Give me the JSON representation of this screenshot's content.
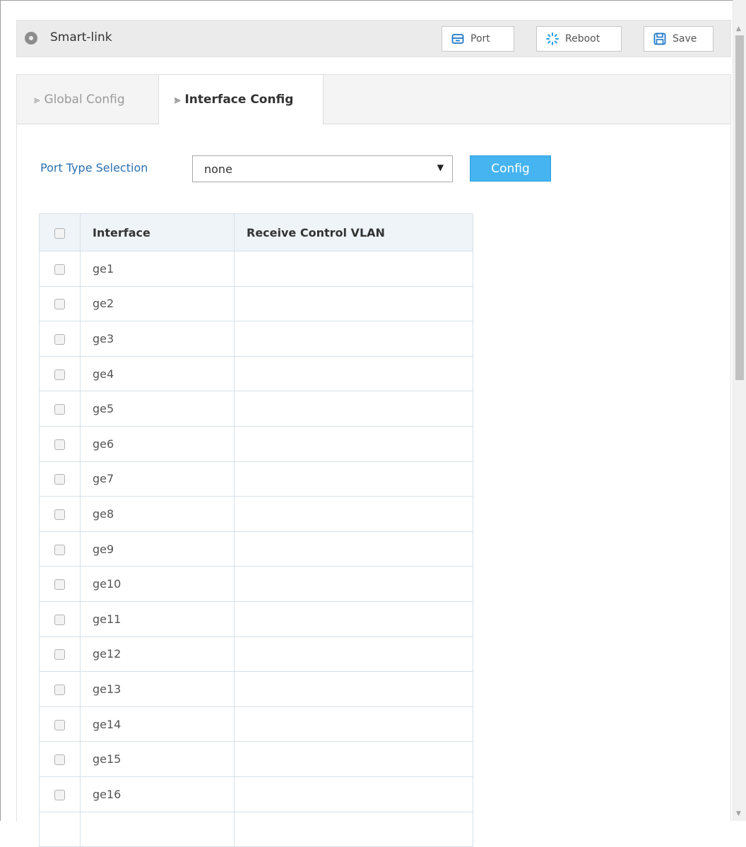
{
  "header": {
    "title": "Smart-link",
    "port_label": "Port",
    "reboot_label": "Reboot",
    "save_label": "Save"
  },
  "tabs": [
    {
      "label": "Global Config",
      "active": false
    },
    {
      "label": "Interface Config",
      "active": true
    }
  ],
  "form": {
    "port_type_label": "Port Type Selection",
    "port_type_value": "none",
    "config_button": "Config"
  },
  "table": {
    "headers": [
      "Interface",
      "Receive Control VLAN"
    ],
    "rows": [
      {
        "interface": "ge1",
        "vlan": ""
      },
      {
        "interface": "ge2",
        "vlan": ""
      },
      {
        "interface": "ge3",
        "vlan": ""
      },
      {
        "interface": "ge4",
        "vlan": ""
      },
      {
        "interface": "ge5",
        "vlan": ""
      },
      {
        "interface": "ge6",
        "vlan": ""
      },
      {
        "interface": "ge7",
        "vlan": ""
      },
      {
        "interface": "ge8",
        "vlan": ""
      },
      {
        "interface": "ge9",
        "vlan": ""
      },
      {
        "interface": "ge10",
        "vlan": ""
      },
      {
        "interface": "ge11",
        "vlan": ""
      },
      {
        "interface": "ge12",
        "vlan": ""
      },
      {
        "interface": "ge13",
        "vlan": ""
      },
      {
        "interface": "ge14",
        "vlan": ""
      },
      {
        "interface": "ge15",
        "vlan": ""
      },
      {
        "interface": "ge16",
        "vlan": ""
      }
    ]
  },
  "colors": {
    "accent": "#45b4f0",
    "label_blue": "#2a6fb0",
    "icon_blue": "#1f78c8"
  }
}
